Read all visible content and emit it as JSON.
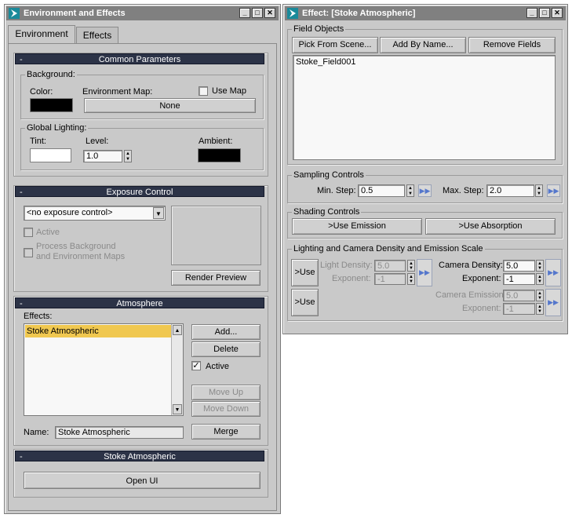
{
  "env_window": {
    "title": "Environment and Effects",
    "tabs": [
      "Environment",
      "Effects"
    ],
    "common": {
      "header": "Common Parameters",
      "background_label": "Background:",
      "color_label": "Color:",
      "env_map_label": "Environment Map:",
      "use_map_label": "Use Map",
      "env_map_button": "None",
      "global_lighting_label": "Global Lighting:",
      "tint_label": "Tint:",
      "level_label": "Level:",
      "level_value": "1.0",
      "ambient_label": "Ambient:",
      "bg_color": "#000000",
      "tint_color": "#ffffff",
      "ambient_color": "#000000"
    },
    "exposure": {
      "header": "Exposure Control",
      "select_value": "<no exposure control>",
      "active_label": "Active",
      "process_line1": "Process Background",
      "process_line2": "and Environment Maps",
      "render_preview": "Render Preview"
    },
    "atmosphere": {
      "header": "Atmosphere",
      "effects_label": "Effects:",
      "effects_list": [
        "Stoke Atmospheric"
      ],
      "add": "Add...",
      "delete": "Delete",
      "active_label": "Active",
      "move_up": "Move Up",
      "move_down": "Move Down",
      "name_label": "Name:",
      "name_value": "Stoke Atmospheric",
      "merge": "Merge"
    },
    "stoke": {
      "header": "Stoke Atmospheric",
      "open_ui": "Open UI"
    }
  },
  "effect_window": {
    "title": "Effect: [Stoke Atmospheric]",
    "field_objects": {
      "label": "Field Objects",
      "pick": "Pick From Scene...",
      "add_by_name": "Add By Name...",
      "remove": "Remove Fields",
      "items": [
        "Stoke_Field001"
      ]
    },
    "sampling": {
      "label": "Sampling Controls",
      "min_label": "Min. Step:",
      "min_value": "0.5",
      "max_label": "Max. Step:",
      "max_value": "2.0"
    },
    "shading": {
      "label": "Shading Controls",
      "use_emission": ">Use Emission",
      "use_absorption": ">Use Absorption"
    },
    "lighting": {
      "label": "Lighting and Camera Density and Emission Scale",
      "use_button": ">Use",
      "light_density_label": "Light Density:",
      "light_density_value": "5.0",
      "exponent_label": "Exponent:",
      "light_exponent_value": "-1",
      "camera_density_label": "Camera Density:",
      "camera_density_value": "5.0",
      "camera_exponent_value": "-1",
      "use_button2": ">Use",
      "camera_emission_label": "Camera Emission:",
      "camera_emission_value": "5.0",
      "emission_exponent_value": "-1"
    }
  }
}
